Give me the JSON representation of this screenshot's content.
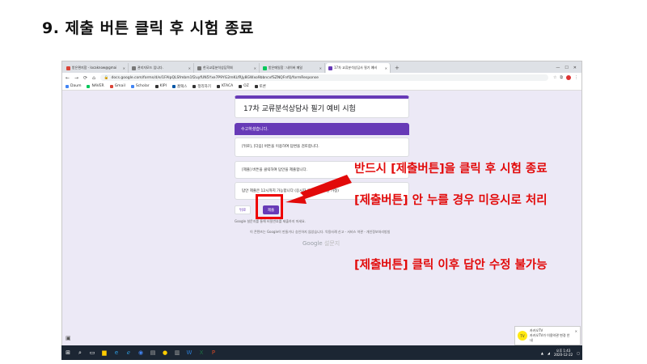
{
  "slide": {
    "title": "9. 제출 버튼 클릭 후 시험 종료"
  },
  "browser": {
    "tabs": [
      {
        "label": "받은편지함 - locaknow@gmai",
        "color": "#db4437"
      },
      {
        "label": "관리자모드 입니다.",
        "color": "#777777"
      },
      {
        "label": "한국교류분석상담학회",
        "color": "#777777"
      },
      {
        "label": "받은메일함 : 네이버 메일",
        "color": "#03c75a"
      },
      {
        "label": "17차 교류분석상담사 필기 예비",
        "color": "#673ab7"
      }
    ],
    "url": "docs.google.com/forms/d/e/1FAIpQLSfmbm1f2uyfUN5Yxe7P9YG2mKLfRJy8GWxo9bbncvfSZNQFnfQ/formResponse",
    "bookmarks": [
      {
        "label": "Daum",
        "color": "#ffffff"
      },
      {
        "label": "NAVER",
        "color": "#03c75a"
      },
      {
        "label": "Gmail",
        "color": "#db4437"
      },
      {
        "label": "Scholar",
        "color": "#4285f4"
      },
      {
        "label": "KIPI",
        "color": "#333333"
      },
      {
        "label": "홈택스",
        "color": "#0055a5"
      },
      {
        "label": "정리하기",
        "color": "#333333"
      },
      {
        "label": "KTACA",
        "color": "#333333"
      },
      {
        "label": "OZ",
        "color": "#333333"
      },
      {
        "label": "토론",
        "color": "#333333"
      }
    ]
  },
  "form": {
    "title": "17차 교류분석상담사 필기 예비 시험",
    "banner": "수고하셨습니다.",
    "card1": "[뒤로], [다음] 버튼을 이용하여 답변을 검토합니다.",
    "card2": "[제출] 버튼을 클릭하여 답안을 제출합니다.",
    "card3": "답안 제출은 12시까지 가능합니다 (응시자 응시 활용 상황 가정)",
    "back_label": "뒤로",
    "submit_label": "제출",
    "note1": "Google 설문지를 통해 비밀번호를 제출하지 마세요.",
    "note2": "이 콘텐츠는 Google이 만들거나 승인하지 않았습니다. 악용사례 신고 - 서비스 약관 - 개인정보처리방침",
    "brand_google": "Google",
    "brand_forms": "설문지"
  },
  "annotations": {
    "line1": "반드시 [제출버튼]을 클릭 후 시험 종료",
    "line2": "[제출버튼] 안 누를 경우 미응시로 처리",
    "line3": "[제출버튼] 클릭 이후 답안 수정 불가능"
  },
  "notification": {
    "app": "카카오TV",
    "message": "카카오TV가 이용약관 변경 안내",
    "icon_text": "TV"
  },
  "taskbar": {
    "time": "오후 1:43",
    "date": "2020-12-22"
  },
  "colors": {
    "accent": "#673ab7",
    "annotation": "#e20a0a",
    "form_bg": "#ece9f6"
  }
}
